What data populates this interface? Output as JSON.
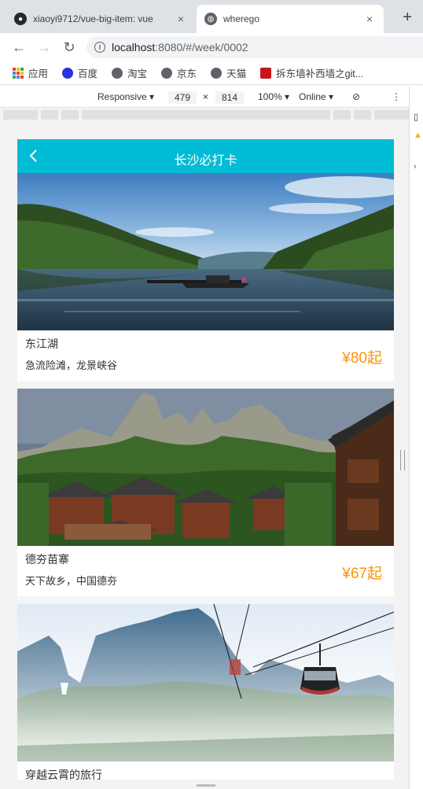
{
  "browser": {
    "tabs": [
      {
        "title": "xiaoyi9712/vue-big-item: vue",
        "close": "×",
        "icon": "github-icon"
      },
      {
        "title": "wherego",
        "close": "×",
        "icon": "globe-icon"
      }
    ],
    "new_tab": "+",
    "url_host": "localhost",
    "url_rest": ":8080/#/week/0002",
    "bookmarks": [
      "应用",
      "百度",
      "淘宝",
      "京东",
      "天猫",
      "拆东墙补西墙之git..."
    ]
  },
  "devtools": {
    "device": "Responsive",
    "width": "479",
    "times": "×",
    "height": "814",
    "zoom": "100%",
    "network": "Online",
    "more": "⋮"
  },
  "app": {
    "title": "长沙必打卡",
    "back_icon": "chevron-left-icon",
    "accent_color": "#00bcd4",
    "price_color": "#ff9300",
    "items": [
      {
        "name": "东江湖",
        "desc": "急流险滩，龙景峡谷",
        "price": "¥80起"
      },
      {
        "name": "德夯苗寨",
        "desc": "天下故乡，中国德夯",
        "price": "¥67起"
      },
      {
        "name": "穿越云霄的旅行",
        "desc": "",
        "price": ""
      }
    ]
  }
}
